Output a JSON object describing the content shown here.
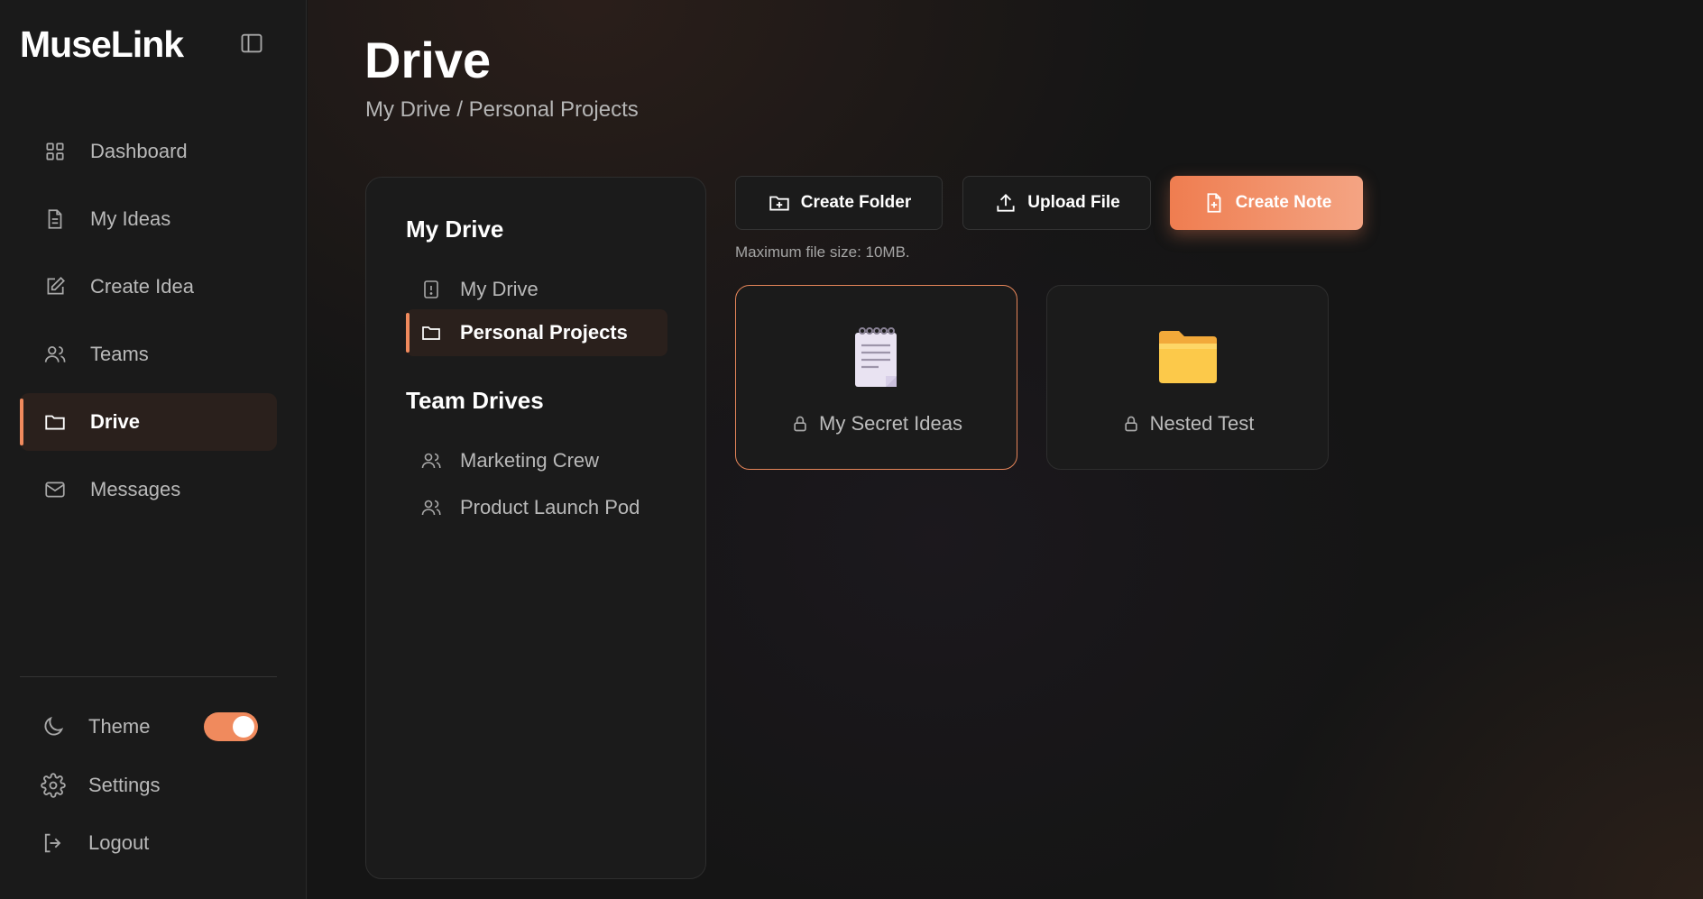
{
  "app": {
    "brand": "MuseLink"
  },
  "sidebar": {
    "items": [
      {
        "label": "Dashboard",
        "icon": "grid-icon",
        "active": false
      },
      {
        "label": "My Ideas",
        "icon": "document-icon",
        "active": false
      },
      {
        "label": "Create Idea",
        "icon": "pencil-square-icon",
        "active": false
      },
      {
        "label": "Teams",
        "icon": "users-icon",
        "active": false
      },
      {
        "label": "Drive",
        "icon": "folder-icon",
        "active": true
      },
      {
        "label": "Messages",
        "icon": "mail-icon",
        "active": false
      }
    ],
    "theme_label": "Theme",
    "theme_toggle_on": true,
    "settings_label": "Settings",
    "logout_label": "Logout"
  },
  "page": {
    "title": "Drive",
    "breadcrumb": "My Drive / Personal Projects"
  },
  "drive_panel": {
    "my_drive_heading": "My Drive",
    "my_drive_items": [
      {
        "label": "My Drive",
        "icon": "drive-alert-icon",
        "active": false
      },
      {
        "label": "Personal Projects",
        "icon": "folder-icon",
        "active": true
      }
    ],
    "team_drives_heading": "Team Drives",
    "team_drive_items": [
      {
        "label": "Marketing Crew",
        "icon": "users-icon"
      },
      {
        "label": "Product Launch Pod",
        "icon": "users-icon"
      }
    ]
  },
  "toolbar": {
    "create_folder": "Create Folder",
    "upload_file": "Upload File",
    "create_note": "Create Note",
    "max_file_note": "Maximum file size: 10MB."
  },
  "items": [
    {
      "name": "My Secret Ideas",
      "type": "note",
      "locked": true,
      "selected": true
    },
    {
      "name": "Nested Test",
      "type": "folder",
      "locked": true,
      "selected": false
    }
  ],
  "colors": {
    "accent": "#f08a5d",
    "background": "#151515",
    "panel": "#1b1b1b"
  }
}
